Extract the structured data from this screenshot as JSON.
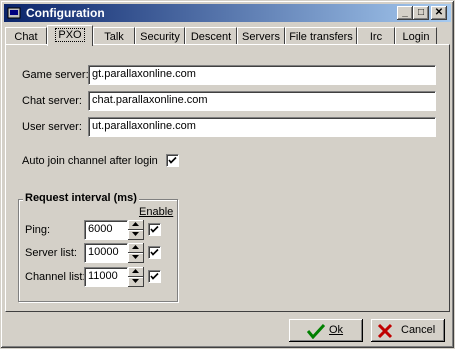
{
  "window": {
    "title": "Configuration"
  },
  "titlebar_buttons": {
    "minimize": "_",
    "maximize": "□",
    "close": "✕"
  },
  "tabs": [
    {
      "label": "Chat"
    },
    {
      "label": "PXO"
    },
    {
      "label": "Talk"
    },
    {
      "label": "Security"
    },
    {
      "label": "Descent"
    },
    {
      "label": "Servers"
    },
    {
      "label": "File transfers"
    },
    {
      "label": "Irc"
    },
    {
      "label": "Login"
    }
  ],
  "active_tab": "PXO",
  "fields": {
    "game_server": {
      "label": "Game server:",
      "value": "gt.parallaxonline.com"
    },
    "chat_server": {
      "label": "Chat server:",
      "value": "chat.parallaxonline.com"
    },
    "user_server": {
      "label": "User server:",
      "value": "ut.parallaxonline.com"
    }
  },
  "auto_join": {
    "label": "Auto join channel after login",
    "checked": true
  },
  "request_interval": {
    "title": "Request interval (ms)",
    "enable_label": "Enable",
    "rows": [
      {
        "label": "Ping:",
        "value": "6000",
        "enabled": true
      },
      {
        "label": "Server list:",
        "value": "10000",
        "enabled": true
      },
      {
        "label": "Channel list:",
        "value": "11000",
        "enabled": true
      }
    ]
  },
  "buttons": {
    "ok": "Ok",
    "cancel": "Cancel"
  },
  "colors": {
    "titlebar_start": "#0a246a",
    "titlebar_end": "#a6caf0",
    "ok_check": "#008000",
    "cancel_x": "#c00000"
  }
}
